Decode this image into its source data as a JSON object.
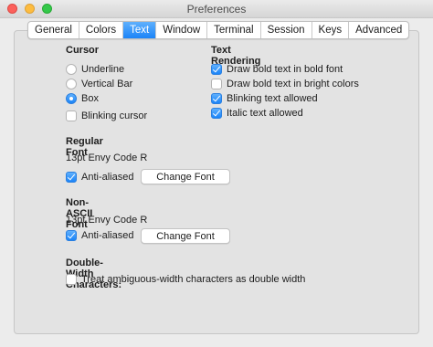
{
  "window": {
    "title": "Preferences"
  },
  "tabs": [
    {
      "label": "General",
      "selected": false
    },
    {
      "label": "Colors",
      "selected": false
    },
    {
      "label": "Text",
      "selected": true
    },
    {
      "label": "Window",
      "selected": false
    },
    {
      "label": "Terminal",
      "selected": false
    },
    {
      "label": "Session",
      "selected": false
    },
    {
      "label": "Keys",
      "selected": false
    },
    {
      "label": "Advanced",
      "selected": false
    }
  ],
  "cursor": {
    "heading": "Cursor",
    "options": [
      {
        "label": "Underline",
        "selected": false
      },
      {
        "label": "Vertical Bar",
        "selected": false
      },
      {
        "label": "Box",
        "selected": true
      }
    ],
    "blinking": {
      "label": "Blinking cursor",
      "checked": false
    }
  },
  "text_rendering": {
    "heading": "Text Rendering",
    "options": [
      {
        "label": "Draw bold text in bold font",
        "checked": true
      },
      {
        "label": "Draw bold text in bright colors",
        "checked": false
      },
      {
        "label": "Blinking text allowed",
        "checked": true
      },
      {
        "label": "Italic text allowed",
        "checked": true
      }
    ]
  },
  "regular_font": {
    "heading": "Regular Font",
    "font": "13pt Envy Code R",
    "anti_aliased": {
      "label": "Anti-aliased",
      "checked": true
    },
    "change_button": "Change Font"
  },
  "non_ascii_font": {
    "heading": "Non-ASCII Font",
    "font": "13pt Envy Code R",
    "anti_aliased": {
      "label": "Anti-aliased",
      "checked": true
    },
    "change_button": "Change Font"
  },
  "double_width": {
    "heading": "Double-Width Characters:",
    "option": {
      "label": "Treat ambiguous-width characters as double width",
      "checked": false
    }
  },
  "colors": {
    "accent": "#1b84f8",
    "close": "#fc605b",
    "minimize": "#fdbc40",
    "maximize": "#34c84a"
  }
}
